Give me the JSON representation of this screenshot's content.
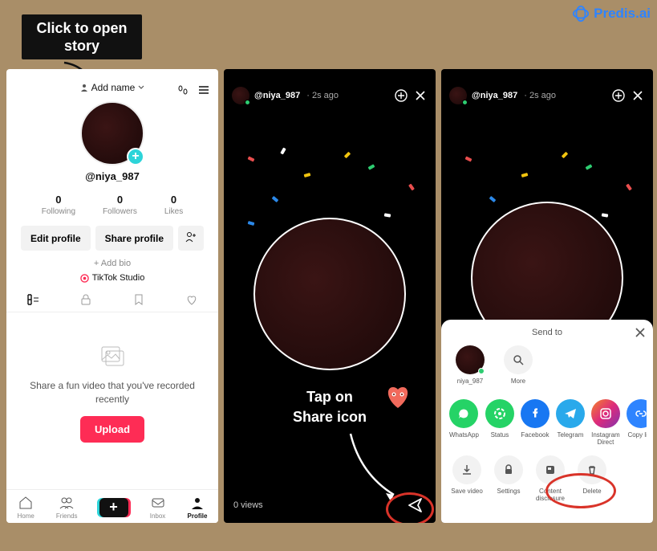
{
  "brand": "Predis.ai",
  "callouts": {
    "open_story": "Click to open story",
    "tap_share": "Tap on\nShare icon",
    "delete": "Delete"
  },
  "profile": {
    "add_name": "Add name",
    "handle": "@niya_987",
    "stats": [
      {
        "n": "0",
        "l": "Following"
      },
      {
        "n": "0",
        "l": "Followers"
      },
      {
        "n": "0",
        "l": "Likes"
      }
    ],
    "edit_profile": "Edit profile",
    "share_profile": "Share profile",
    "add_bio": "+ Add bio",
    "studio": "TikTok Studio",
    "empty_msg": "Share a fun video that you've recorded recently",
    "upload": "Upload",
    "nav": {
      "home": "Home",
      "friends": "Friends",
      "inbox": "Inbox",
      "profile": "Profile"
    }
  },
  "story": {
    "user": "@niya_987",
    "time": "2s ago",
    "views": "0 views"
  },
  "sheet": {
    "title": "Send to",
    "contact": "niya_987",
    "more": "More",
    "apps": [
      {
        "id": "whatsapp",
        "label": "WhatsApp"
      },
      {
        "id": "status",
        "label": "Status"
      },
      {
        "id": "facebook",
        "label": "Facebook"
      },
      {
        "id": "telegram",
        "label": "Telegram"
      },
      {
        "id": "instagram",
        "label": "Instagram Direct"
      },
      {
        "id": "copylink",
        "label": "Copy link"
      }
    ],
    "actions": [
      {
        "id": "save",
        "label": "Save video"
      },
      {
        "id": "settings",
        "label": "Settings"
      },
      {
        "id": "content",
        "label": "Content disclosure"
      },
      {
        "id": "delete",
        "label": "Delete"
      }
    ]
  }
}
